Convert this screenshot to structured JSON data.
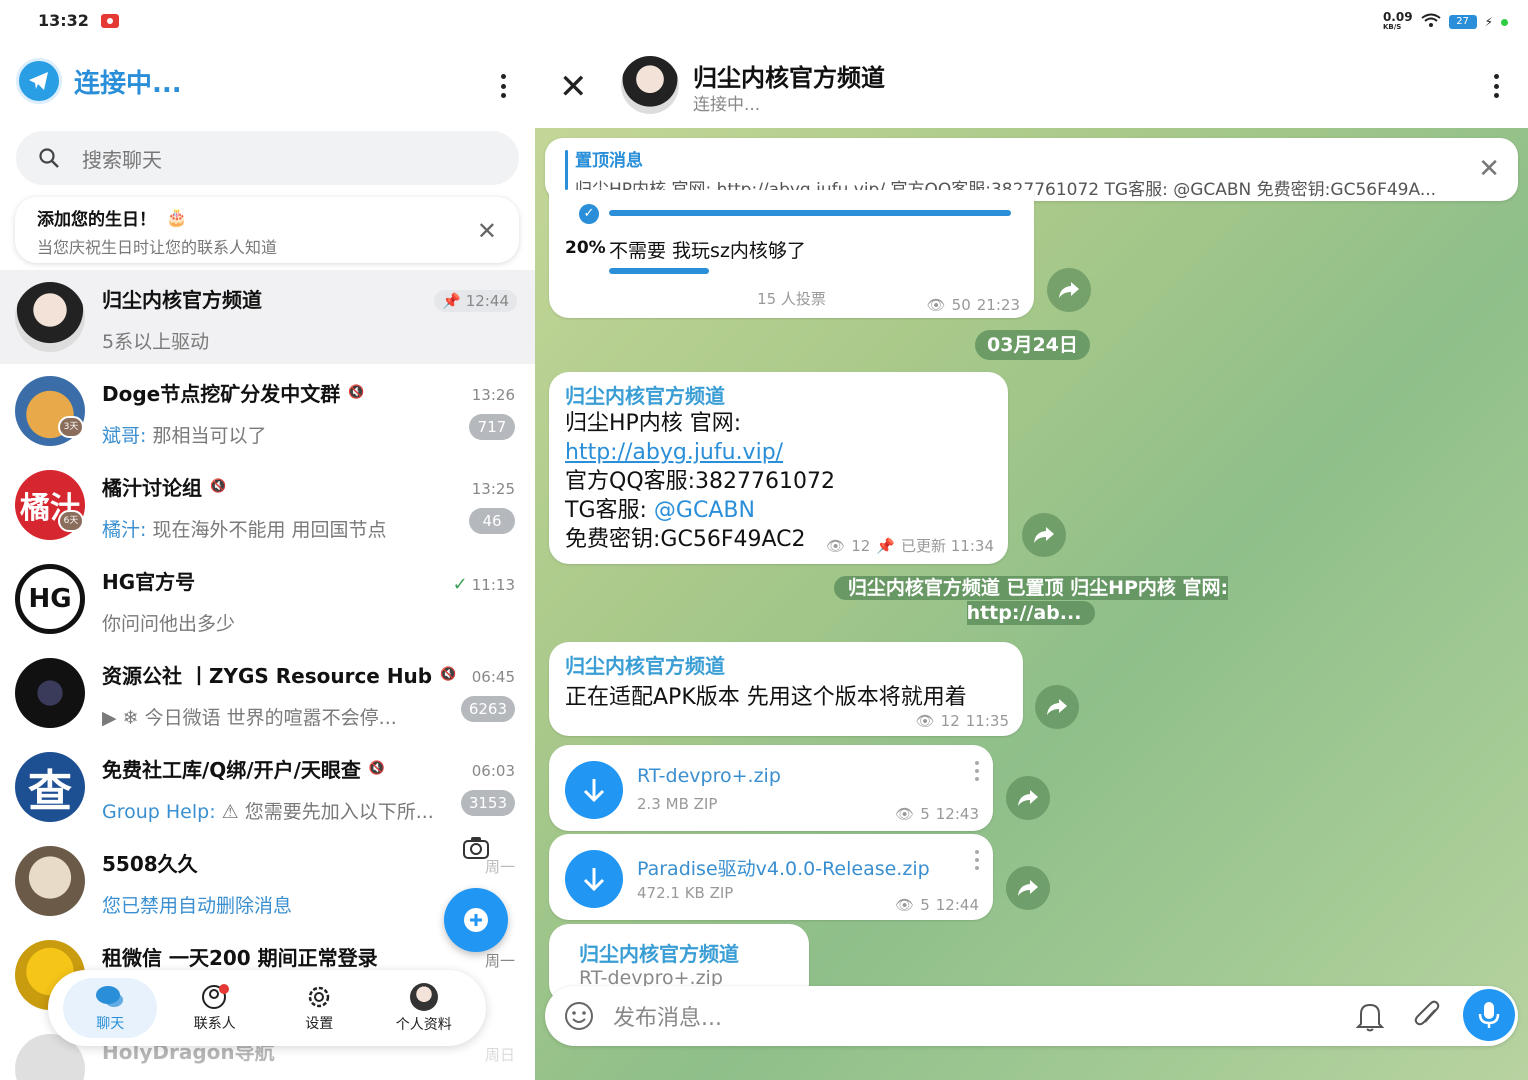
{
  "status": {
    "time": "13:32",
    "net_speed": "0.09",
    "net_unit": "KB/S",
    "battery": "27"
  },
  "left": {
    "app_title": "连接中...",
    "search_placeholder": "搜索聊天",
    "birthday": {
      "title": "添加您的生日！",
      "subtitle": "当您庆祝生日时让您的联系人知道"
    },
    "chats": [
      {
        "name": "归尘内核官方频道",
        "preview": "5系以上驱动",
        "time": "12:44"
      },
      {
        "name": "Doge节点挖矿分发中文群",
        "who": "斌哥: ",
        "preview": "那相当可以了",
        "time": "13:26",
        "badge": "717",
        "story": "3天"
      },
      {
        "name": "橘汁讨论组",
        "who": "橘汁: ",
        "preview": "现在海外不能用 用回国节点",
        "time": "13:25",
        "badge": "46",
        "story": "6天"
      },
      {
        "name": "HG官方号",
        "preview": "你问问他出多少",
        "time": "11:13"
      },
      {
        "name": "资源公社 丨ZYGS Resource Hub",
        "preview": "今日微语 世界的喧嚣不会停...",
        "time": "06:45",
        "badge": "6263"
      },
      {
        "name": "免费社工库/Q绑/开户/天眼查",
        "who": "Group Help: ",
        "preview": "您需要先加入以下所...",
        "time": "06:03",
        "badge": "3153"
      },
      {
        "name": "5508久久",
        "who": "您已禁用自动删除消息",
        "preview": "",
        "time": "周一"
      },
      {
        "name": "租微信 一天200 期间正常登录",
        "preview": "",
        "time": "周一"
      },
      {
        "name": "HolyDragon导航",
        "preview": "",
        "time": "周日"
      }
    ],
    "tabs": {
      "chats": "聊天",
      "contacts": "联系人",
      "settings": "设置",
      "profile": "个人资料"
    }
  },
  "right": {
    "channel_title": "归尘内核官方频道",
    "channel_status": "连接中...",
    "pinned": {
      "title": "置顶消息",
      "text": "归尘HP内核 官网: http://abyg.jufu.vip/ 官方QQ客服:3827761072 TG客服: @GCABN 免费密钥:GC56F49A..."
    },
    "poll": {
      "pct": "20%",
      "option": "不需要 我玩sz内核够了",
      "votes": "15 人投票",
      "views": "50",
      "time": "21:23"
    },
    "date": "03月24日",
    "msg1": {
      "channel": "归尘内核官方频道",
      "line1": "归尘HP内核 官网:",
      "link": "http://abyg.jufu.vip/",
      "line3": "官方QQ客服:3827761072",
      "tg_label": "TG客服: ",
      "tg_handle": "@GCABN",
      "line5": "免费密钥:GC56F49AC2",
      "views": "12",
      "edited": "已更新 11:34"
    },
    "system": "归尘内核官方频道 已置顶 归尘HP内核 官网: http://ab...",
    "msg2": {
      "channel": "归尘内核官方频道",
      "text": "正在适配APK版本 先用这个版本将就用着",
      "views": "12",
      "time": "11:35"
    },
    "file1": {
      "name": "RT-devpro+.zip",
      "size": "2.3 MB ZIP",
      "views": "5",
      "time": "12:43"
    },
    "file2": {
      "name": "Paradise驱动v4.0.0-Release.zip",
      "size": "472.1 KB ZIP",
      "views": "5",
      "time": "12:44"
    },
    "msg3": {
      "channel": "归尘内核官方频道",
      "preview": "RT-devpro+.zip"
    },
    "composer_placeholder": "发布消息..."
  }
}
